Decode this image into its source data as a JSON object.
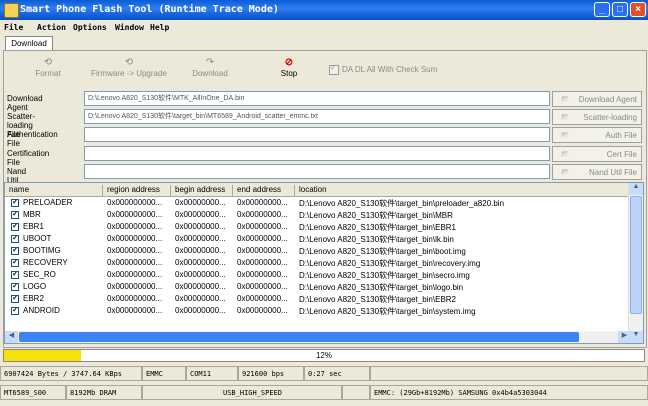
{
  "window": {
    "title": "Smart Phone Flash Tool (Runtime Trace Mode)",
    "controls": [
      "_",
      "□",
      "×"
    ]
  },
  "menu": [
    "File",
    "Action",
    "Options",
    "Window",
    "Help"
  ],
  "tab": "Download",
  "toolbar": {
    "format": "Format",
    "firmware_upgrade": "Firmware -> Upgrade",
    "download": "Download",
    "stop": "Stop",
    "da_checksum": "DA DL All With Check Sum"
  },
  "fields": [
    {
      "label": "Download Agent",
      "value": "D:\\Lenovo A820_S130软件\\MTK_AllInOne_DA.bin",
      "button": "Download Agent"
    },
    {
      "label": "Scatter-loading File",
      "value": "D:\\Lenovo A820_S130软件\\target_bin\\MT6589_Android_scatter_emmc.txt",
      "button": "Scatter-loading"
    },
    {
      "label": "Authentication File",
      "value": "",
      "button": "Auth File"
    },
    {
      "label": "Certification File",
      "value": "",
      "button": "Cert File"
    },
    {
      "label": "Nand Util File",
      "value": "",
      "button": "Nand Util File"
    }
  ],
  "table": {
    "columns": [
      "name",
      "region address",
      "begin address",
      "end address",
      "location"
    ],
    "rows": [
      {
        "name": "PRELOADER",
        "region": "0x000000000...",
        "begin": "0x00000000...",
        "end": "0x00000000...",
        "location": "D:\\Lenovo A820_S130软件\\target_bin\\preloader_a820.bin"
      },
      {
        "name": "MBR",
        "region": "0x000000000...",
        "begin": "0x00000000...",
        "end": "0x00000000...",
        "location": "D:\\Lenovo A820_S130软件\\target_bin\\MBR"
      },
      {
        "name": "EBR1",
        "region": "0x000000000...",
        "begin": "0x00000000...",
        "end": "0x00000000...",
        "location": "D:\\Lenovo A820_S130软件\\target_bin\\EBR1"
      },
      {
        "name": "UBOOT",
        "region": "0x000000000...",
        "begin": "0x00000000...",
        "end": "0x00000000...",
        "location": "D:\\Lenovo A820_S130软件\\target_bin\\lk.bin"
      },
      {
        "name": "BOOTIMG",
        "region": "0x000000000...",
        "begin": "0x00000000...",
        "end": "0x00000000...",
        "location": "D:\\Lenovo A820_S130软件\\target_bin\\boot.img"
      },
      {
        "name": "RECOVERY",
        "region": "0x000000000...",
        "begin": "0x00000000...",
        "end": "0x00000000...",
        "location": "D:\\Lenovo A820_S130软件\\target_bin\\recovery.img"
      },
      {
        "name": "SEC_RO",
        "region": "0x000000000...",
        "begin": "0x00000000...",
        "end": "0x00000000...",
        "location": "D:\\Lenovo A820_S130软件\\target_bin\\secro.img"
      },
      {
        "name": "LOGO",
        "region": "0x000000000...",
        "begin": "0x00000000...",
        "end": "0x00000000...",
        "location": "D:\\Lenovo A820_S130软件\\target_bin\\logo.bin"
      },
      {
        "name": "EBR2",
        "region": "0x000000000...",
        "begin": "0x00000000...",
        "end": "0x00000000...",
        "location": "D:\\Lenovo A820_S130软件\\target_bin\\EBR2"
      },
      {
        "name": "ANDROID",
        "region": "0x000000000...",
        "begin": "0x00000000...",
        "end": "0x00000000...",
        "location": "D:\\Lenovo A820_S130软件\\target_bin\\system.img"
      }
    ]
  },
  "progress": {
    "value": 12,
    "label": "12%",
    "color": "#f4e20a"
  },
  "status1": [
    "6907424 Bytes / 3747.64 KBps",
    "EMMC",
    "COM11",
    "921600 bps",
    "0:27 sec",
    ""
  ],
  "status2": [
    "MT6589_S00",
    "8192Mb DRAM",
    "USB_HIGH_SPEED",
    "",
    "EMMC: (29Gb+8192Mb) SAMSUNG 0x4b4a5303044"
  ],
  "colors": {
    "titlebar": "#0a5cd8",
    "stop": "#e00000",
    "scroll": "#3c84f2"
  }
}
